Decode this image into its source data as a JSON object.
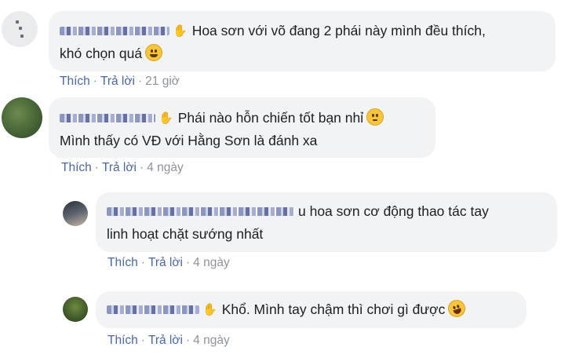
{
  "comments": [
    {
      "text_line1": "Hoa sơn với võ đang 2 phái này mình đều thích,",
      "text_line2": "khó chọn quá",
      "emoji": "grinning-face",
      "actions": {
        "like": "Thích",
        "reply": "Trả lời",
        "time": "21 giờ"
      }
    },
    {
      "text_line1": "Phái nào hỗn chiến tốt bạn nhỉ",
      "text_line2": "Mình thấy có VĐ với Hằng Sơn là đánh xa",
      "emoji": "neutral-face",
      "actions": {
        "like": "Thích",
        "reply": "Trả lời",
        "time": "4 ngày"
      }
    },
    {
      "text_line1": "u hoa sơn cơ động thao tác tay",
      "text_line2": "linh hoạt chặt sướng nhất",
      "actions": {
        "like": "Thích",
        "reply": "Trả lời",
        "time": "4 ngày"
      }
    },
    {
      "text_line1": "Khổ. Mình tay chậm thì chơi gì được",
      "emoji": "rolling-on-floor-laughing",
      "actions": {
        "like": "Thích",
        "reply": "Trả lời",
        "time": "4 ngày"
      }
    }
  ],
  "dot": "·",
  "hand_icon": "✋"
}
